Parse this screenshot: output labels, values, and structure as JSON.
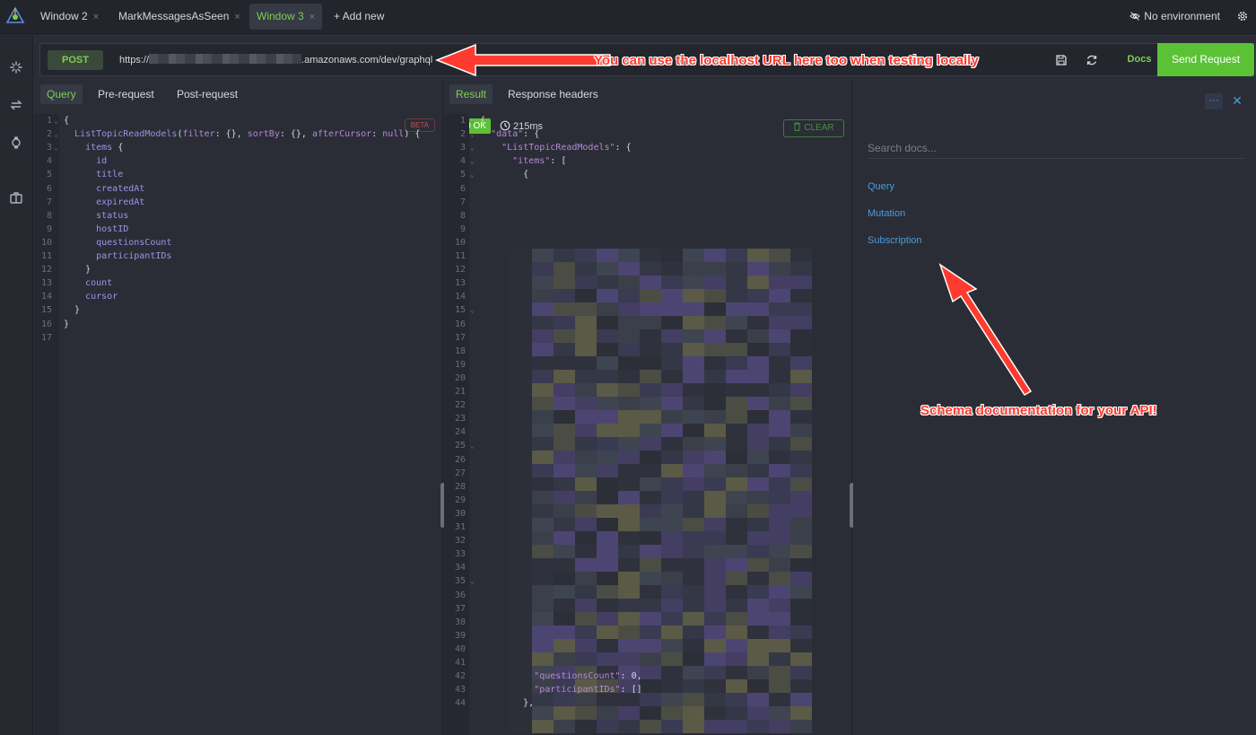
{
  "window_tabs": [
    {
      "label": "Window 2",
      "close": "×",
      "active": false
    },
    {
      "label": "MarkMessagesAsSeen",
      "close": "×",
      "active": false
    },
    {
      "label": "Window 3",
      "close": "×",
      "active": true
    }
  ],
  "add_new_label": "+ Add new",
  "environment_label": "No environment",
  "request": {
    "method": "POST",
    "url_prefix": "https://",
    "url_suffix": ".amazonaws.com/dev/graphql",
    "docs_label": "Docs",
    "send_label": "Send Request"
  },
  "query_pane": {
    "tabs": [
      "Query",
      "Pre-request",
      "Post-request"
    ],
    "beta_badge": "BETA",
    "line_numbers": [
      "1",
      "2",
      "3",
      "4",
      "5",
      "6",
      "7",
      "8",
      "9",
      "10",
      "11",
      "12",
      "13",
      "14",
      "15",
      "16",
      "17"
    ],
    "lines": [
      "{",
      "  ListTopicReadModels(filter: {}, sortBy: {}, afterCursor: null) {",
      "    items {",
      "      id",
      "      title",
      "      createdAt",
      "      expiredAt",
      "      status",
      "      hostID",
      "      questionsCount",
      "      participantIDs",
      "    }",
      "    count",
      "    cursor",
      "  }",
      "}",
      ""
    ]
  },
  "result_pane": {
    "tabs": [
      "Result",
      "Response headers"
    ],
    "status": "200 OK",
    "timing": "215ms",
    "clear_label": "CLEAR",
    "line_numbers": [
      "1",
      "2",
      "3",
      "4",
      "5",
      "6",
      "7",
      "8",
      "9",
      "10",
      "11",
      "12",
      "13",
      "14",
      "15",
      "16",
      "17",
      "18",
      "19",
      "20",
      "21",
      "22",
      "23",
      "24",
      "25",
      "26",
      "27",
      "28",
      "29",
      "30",
      "31",
      "32",
      "33",
      "34",
      "35",
      "36",
      "37",
      "38",
      "39",
      "40",
      "41",
      "42",
      "43",
      "44"
    ],
    "visible_lines": {
      "1": "{",
      "2": "  \"data\": {",
      "3": "    \"ListTopicReadModels\": {",
      "4": "      \"items\": [",
      "5": "        {",
      "42": "          \"questionsCount\": 0,",
      "43": "          \"participantIDs\": []",
      "44": "        },"
    }
  },
  "docs_pane": {
    "more_label": "···",
    "close_label": "✕",
    "search_placeholder": "Search docs...",
    "links": [
      "Query",
      "Mutation",
      "Subscription"
    ]
  },
  "annotations": {
    "url_note": "You can use the localhost URL here too when testing locally",
    "schema_note": "Schema documentation for your API!"
  },
  "icons": {
    "logo": "altair-logo-icon",
    "environment": "eye-off-icon",
    "settings": "gear-icon",
    "rail": [
      "loading-icon",
      "swap-icon",
      "history-icon",
      "collection-icon"
    ],
    "save": "save-icon",
    "reload": "reload-icon",
    "clock": "clock-icon",
    "trash": "trash-icon"
  },
  "colors": {
    "accent_green": "#5bc236",
    "link_blue": "#4a9edb",
    "annotation_red": "#ff3b2f",
    "background": "#2a2d36"
  }
}
